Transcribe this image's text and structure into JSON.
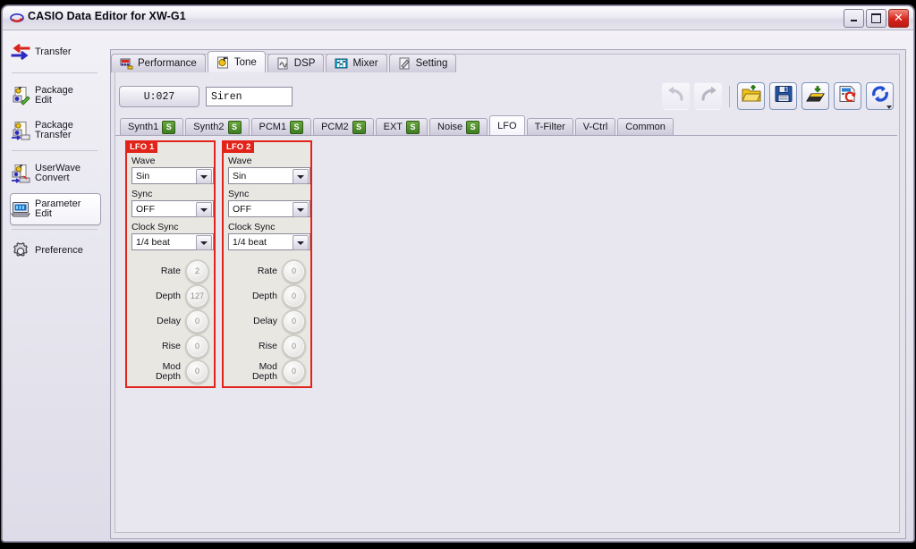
{
  "window": {
    "title": "CASIO Data Editor for XW-G1",
    "icon": "casio-logo-icon",
    "buttons": {
      "minimize": "minimize-button",
      "maximize": "maximize-button",
      "close": "close-button"
    }
  },
  "sidebar": {
    "items": [
      {
        "label": "Transfer",
        "icon": "transfer-arrows-icon",
        "selected": false
      },
      {
        "label": "Package\nEdit",
        "icon": "package-edit-icon",
        "selected": false
      },
      {
        "label": "Package\nTransfer",
        "icon": "package-transfer-icon",
        "selected": false
      },
      {
        "label": "UserWave\nConvert",
        "icon": "userwave-convert-icon",
        "selected": false
      },
      {
        "label": "Parameter\nEdit",
        "icon": "parameter-edit-icon",
        "selected": true
      },
      {
        "label": "Preference",
        "icon": "gear-icon",
        "selected": false
      }
    ]
  },
  "tabs": [
    {
      "label": "Performance",
      "icon": "performance-icon",
      "active": false
    },
    {
      "label": "Tone",
      "icon": "tone-icon",
      "active": true
    },
    {
      "label": "DSP",
      "icon": "dsp-icon",
      "active": false
    },
    {
      "label": "Mixer",
      "icon": "mixer-icon",
      "active": false
    },
    {
      "label": "Setting",
      "icon": "setting-icon",
      "active": false
    }
  ],
  "header": {
    "tone_number": "U:027",
    "tone_name": "Siren"
  },
  "toolbar": {
    "buttons": [
      {
        "name": "undo",
        "icon": "undo-arrow-icon",
        "enabled": false,
        "framed": false
      },
      {
        "name": "redo",
        "icon": "redo-arrow-icon",
        "enabled": false,
        "framed": false
      },
      {
        "name": "open",
        "icon": "open-folder-icon",
        "enabled": true,
        "framed": true
      },
      {
        "name": "save",
        "icon": "floppy-save-icon",
        "enabled": true,
        "framed": true
      },
      {
        "name": "write",
        "icon": "write-to-device-icon",
        "enabled": true,
        "framed": true
      },
      {
        "name": "restore",
        "icon": "restore-data-icon",
        "enabled": true,
        "framed": true
      },
      {
        "name": "refresh",
        "icon": "refresh-sync-icon",
        "enabled": true,
        "framed": true
      }
    ]
  },
  "subtabs": [
    {
      "label": "Synth1",
      "badge": "S",
      "active": false
    },
    {
      "label": "Synth2",
      "badge": "S",
      "active": false
    },
    {
      "label": "PCM1",
      "badge": "S",
      "active": false
    },
    {
      "label": "PCM2",
      "badge": "S",
      "active": false
    },
    {
      "label": "EXT",
      "badge": "S",
      "active": false
    },
    {
      "label": "Noise",
      "badge": "S",
      "active": false
    },
    {
      "label": "LFO",
      "badge": "",
      "active": true
    },
    {
      "label": "T-Filter",
      "badge": "",
      "active": false
    },
    {
      "label": "V-Ctrl",
      "badge": "",
      "active": false
    },
    {
      "label": "Common",
      "badge": "",
      "active": false
    }
  ],
  "colors": {
    "panel_border": "#e2231a",
    "panel_title_bg": "#e2231a",
    "badge_green": "#4d8a2a",
    "panel_bg": "#e9e7e2"
  },
  "panels": [
    {
      "title": "LFO 1",
      "fields": [
        {
          "label": "Wave",
          "value": "Sin"
        },
        {
          "label": "Sync",
          "value": "OFF"
        },
        {
          "label": "Clock Sync",
          "value": "1/4 beat"
        }
      ],
      "knobs": [
        {
          "label": "Rate",
          "value": "2"
        },
        {
          "label": "Depth",
          "value": "127"
        },
        {
          "label": "Delay",
          "value": "0"
        },
        {
          "label": "Rise",
          "value": "0"
        },
        {
          "label": "Mod\nDepth",
          "value": "0"
        }
      ]
    },
    {
      "title": "LFO 2",
      "fields": [
        {
          "label": "Wave",
          "value": "Sin"
        },
        {
          "label": "Sync",
          "value": "OFF"
        },
        {
          "label": "Clock Sync",
          "value": "1/4 beat"
        }
      ],
      "knobs": [
        {
          "label": "Rate",
          "value": "0"
        },
        {
          "label": "Depth",
          "value": "0"
        },
        {
          "label": "Delay",
          "value": "0"
        },
        {
          "label": "Rise",
          "value": "0"
        },
        {
          "label": "Mod\nDepth",
          "value": "0"
        }
      ]
    }
  ]
}
